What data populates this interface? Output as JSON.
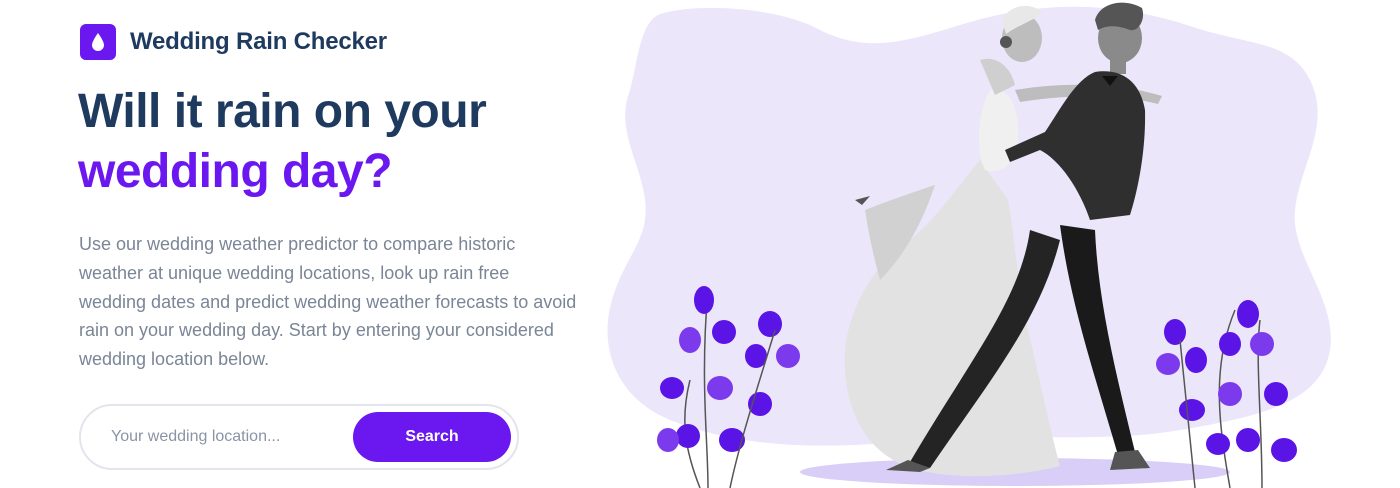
{
  "brand": {
    "name": "Wedding Rain Checker",
    "logo_icon": "raindrop-icon",
    "accent_color": "#6b17f0"
  },
  "hero": {
    "title_line1": "Will it rain on your",
    "title_line2": "wedding day?",
    "description": "Use our wedding weather predictor to compare historic weather at unique wedding locations, look up rain free wedding dates and predict wedding weather forecasts to avoid rain on your wedding day. Start by entering your considered wedding location below."
  },
  "search": {
    "placeholder": "Your wedding location...",
    "value": "",
    "button_label": "Search"
  },
  "illustration": {
    "subject": "dancing-couple-illustration",
    "colors": {
      "blob": "#ece6fb",
      "leaves": "#5a14e6",
      "suit": "#2b2b2b",
      "dress": "#e0e0e0"
    }
  }
}
